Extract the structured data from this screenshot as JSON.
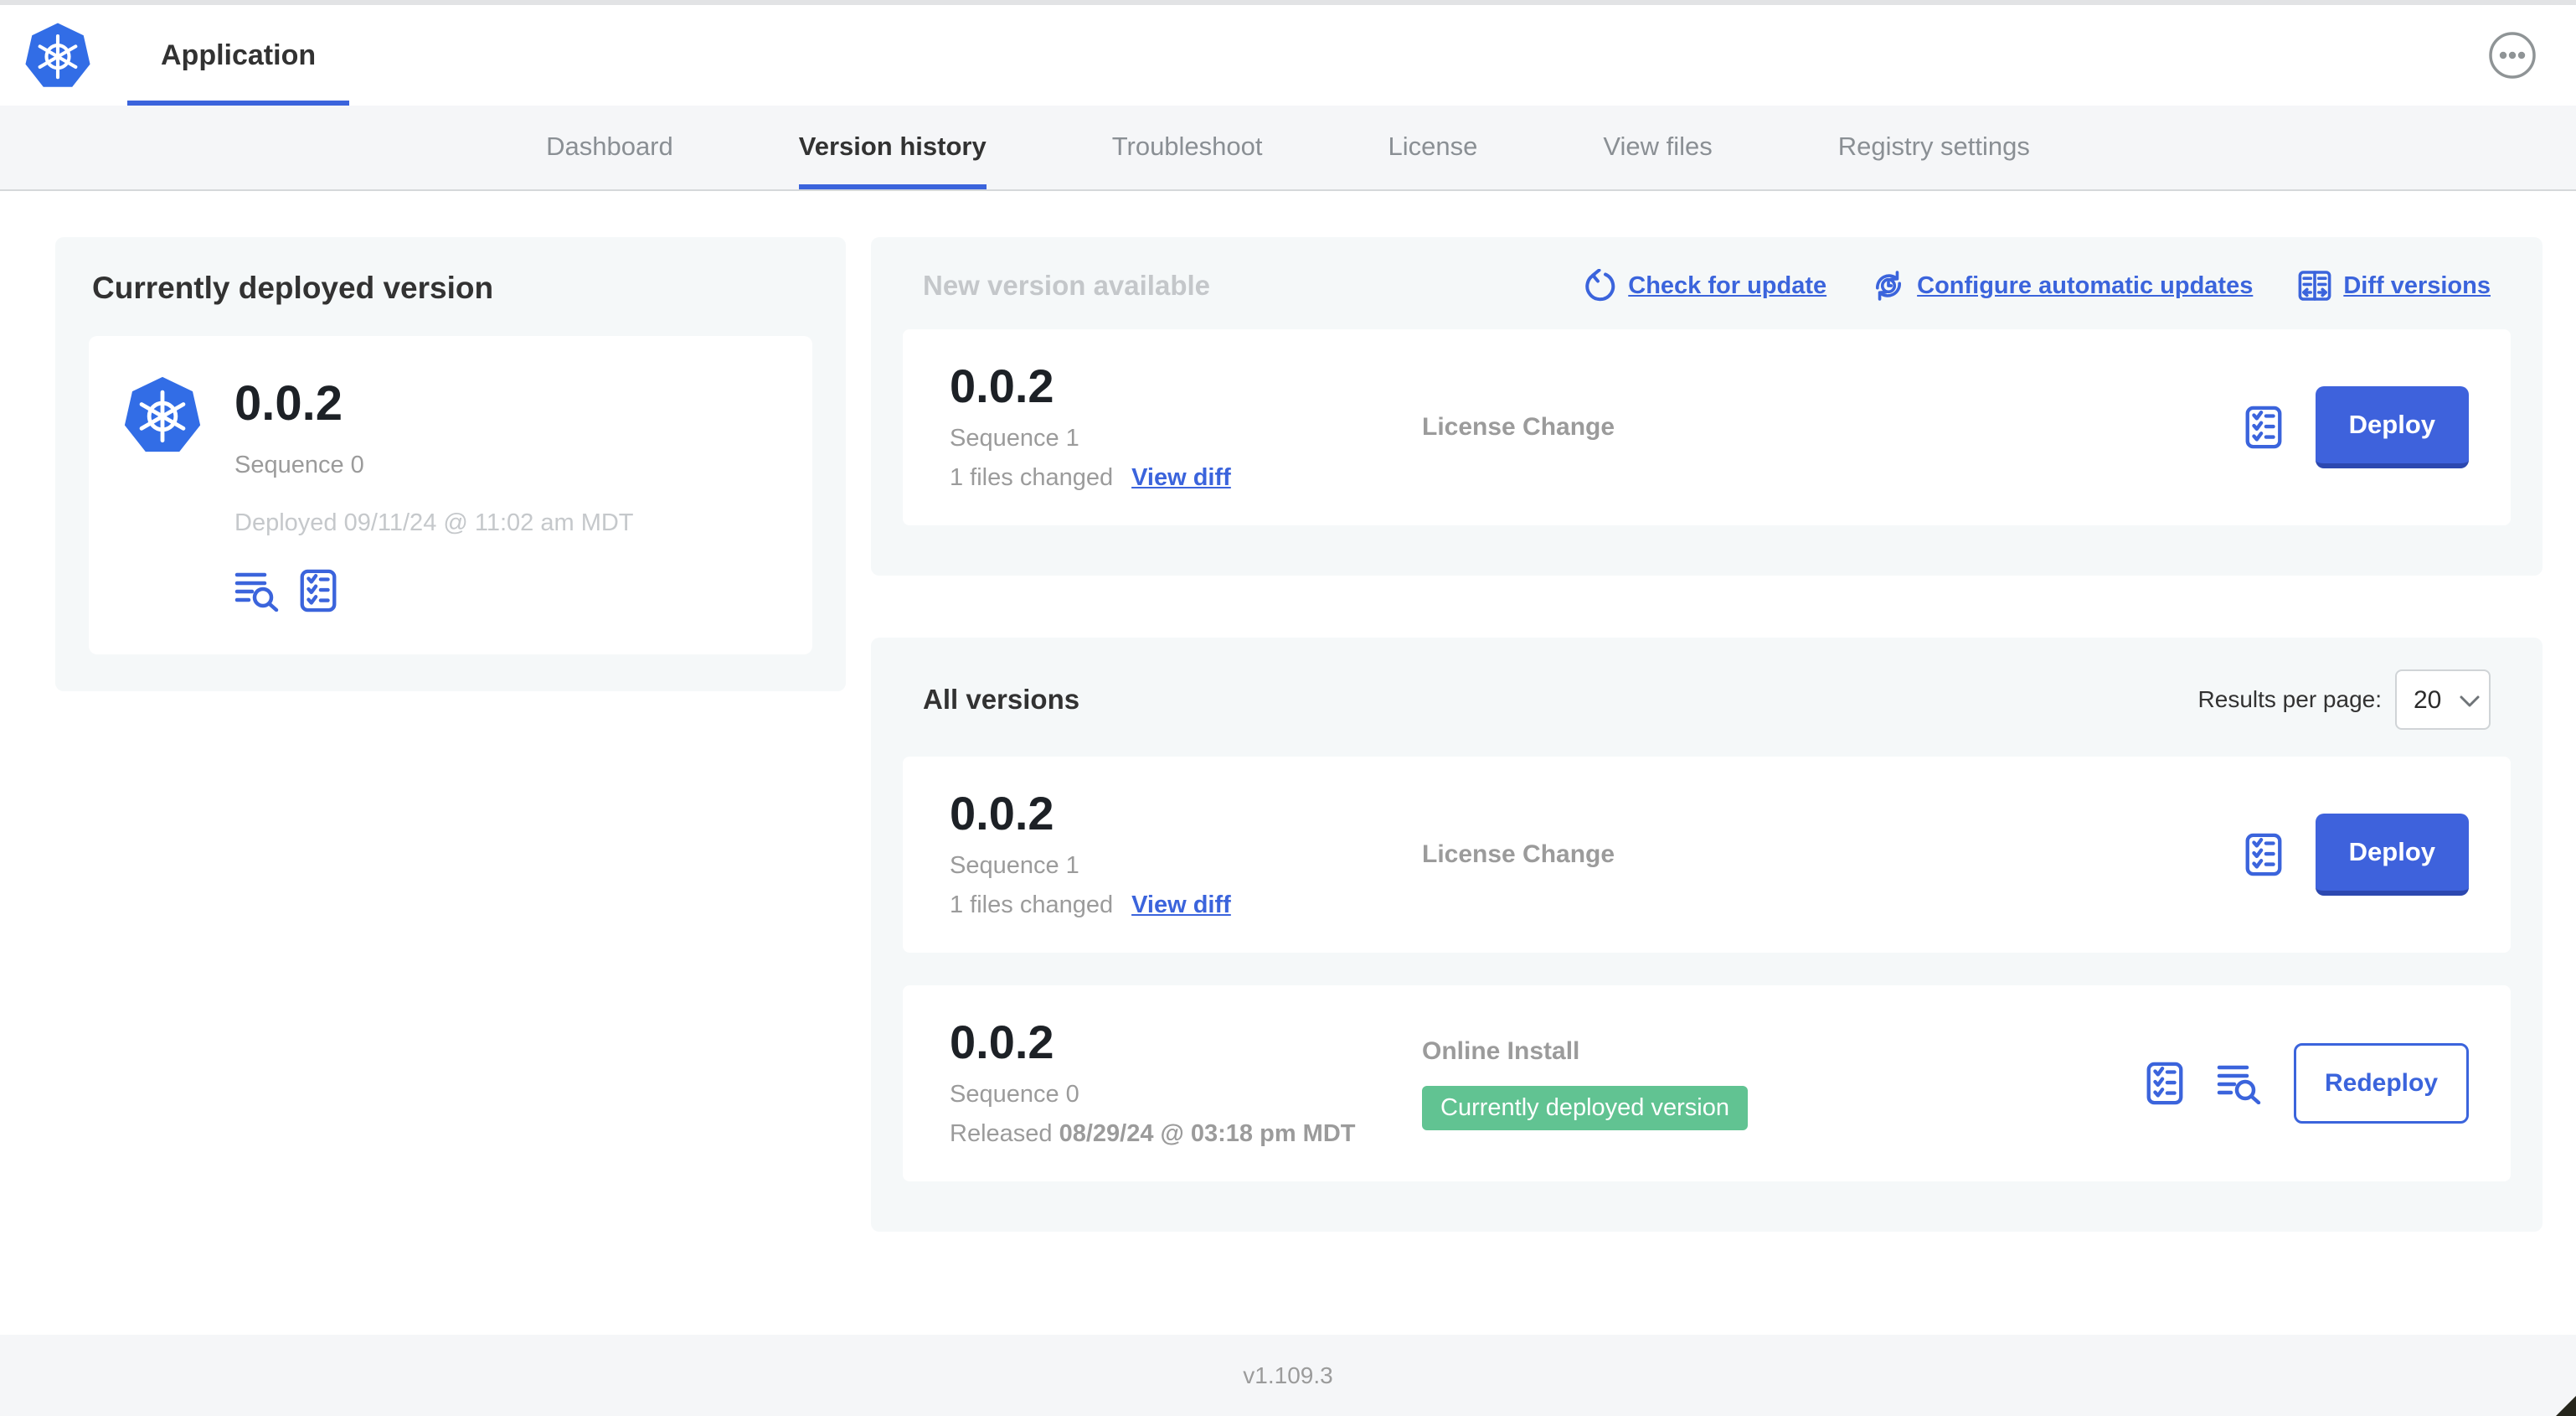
{
  "header": {
    "app_title": "Application"
  },
  "nav": {
    "tabs": [
      {
        "label": "Dashboard",
        "active": false
      },
      {
        "label": "Version history",
        "active": true
      },
      {
        "label": "Troubleshoot",
        "active": false
      },
      {
        "label": "License",
        "active": false
      },
      {
        "label": "View files",
        "active": false
      },
      {
        "label": "Registry settings",
        "active": false
      }
    ]
  },
  "current_version_panel": {
    "title": "Currently deployed version",
    "version": "0.0.2",
    "sequence": "Sequence 0",
    "deployed": "Deployed 09/11/24 @ 11:02 am MDT"
  },
  "new_version_section": {
    "title": "New version available",
    "actions": [
      {
        "label": "Check for update",
        "icon": "refresh-icon"
      },
      {
        "label": "Configure automatic updates",
        "icon": "clock-refresh-icon"
      },
      {
        "label": "Diff versions",
        "icon": "diff-icon"
      }
    ],
    "card": {
      "version": "0.0.2",
      "sequence": "Sequence 1",
      "files_changed": "1 files changed",
      "view_diff_label": "View diff",
      "source": "License Change",
      "action_label": "Deploy"
    }
  },
  "all_versions_section": {
    "title": "All versions",
    "results_per_page_label": "Results per page:",
    "results_per_page_value": "20",
    "rows": [
      {
        "version": "0.0.2",
        "sequence": "Sequence 1",
        "files_changed": "1 files changed",
        "view_diff_label": "View diff",
        "source": "License Change",
        "action_label": "Deploy"
      },
      {
        "version": "0.0.2",
        "sequence": "Sequence 0",
        "released_prefix": "Released ",
        "released_date": "08/29/24 @ 03:18 pm MDT",
        "source": "Online Install",
        "badge": "Currently deployed version",
        "action_label": "Redeploy"
      }
    ]
  },
  "footer": {
    "version": "v1.109.3"
  },
  "colors": {
    "primary_blue": "#3b64dc",
    "button_blue": "#3e62dc",
    "logo_blue": "#326de6",
    "badge_green": "#61c392",
    "text_dark": "#323232",
    "text_gray": "#9b9b9b",
    "text_muted": "#c4c7ca",
    "section_bg": "#f5f8f9"
  }
}
